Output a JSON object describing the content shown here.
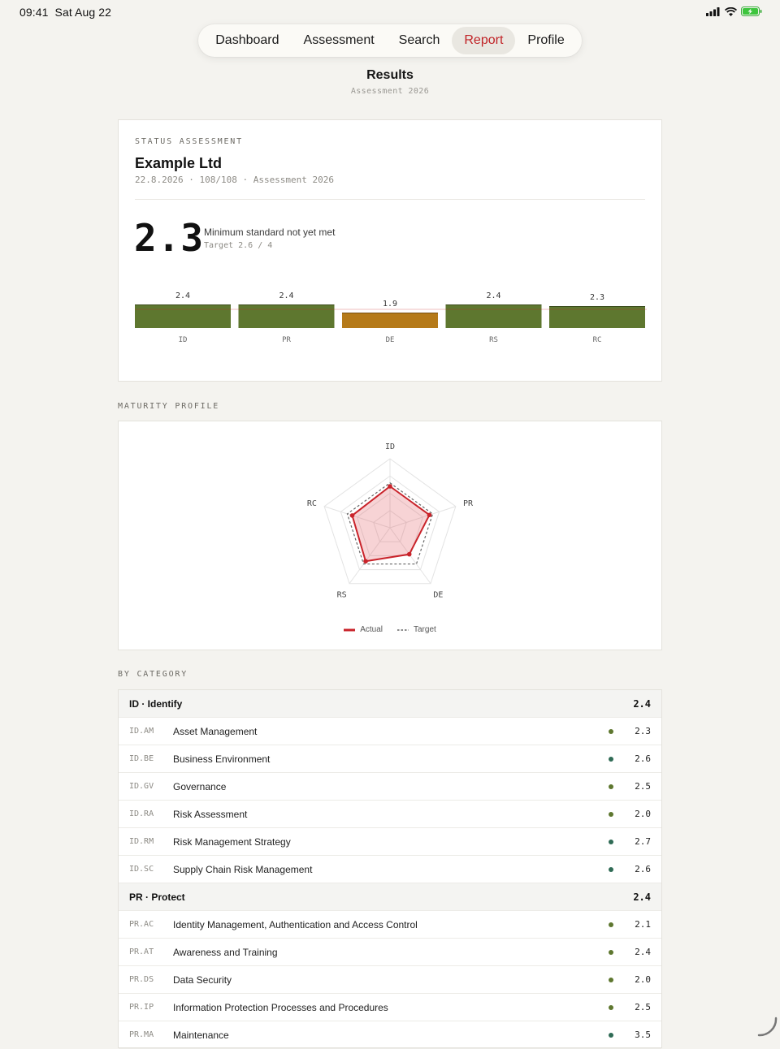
{
  "status_bar": {
    "time": "09:41",
    "date": "Sat Aug 22"
  },
  "nav": {
    "items": [
      {
        "label": "Dashboard",
        "active": false
      },
      {
        "label": "Assessment",
        "active": false
      },
      {
        "label": "Search",
        "active": false
      },
      {
        "label": "Report",
        "active": true
      },
      {
        "label": "Profile",
        "active": false
      }
    ]
  },
  "header": {
    "title": "Results",
    "subtitle": "Assessment 2026"
  },
  "status_card": {
    "eyebrow": "STATUS ASSESSMENT",
    "company": "Example Ltd",
    "meta": "22.8.2026 · 108/108 · Assessment 2026",
    "score": "2.3",
    "score_text": "Minimum standard not yet met",
    "target_text": "Target 2.6 / 4"
  },
  "colors": {
    "green": "#5e772f",
    "amber": "#b57a19",
    "red": "#c9232a",
    "accent": "#c02226",
    "dot_olive": "#5e772f",
    "dot_teal": "#2f6b55"
  },
  "chart_data": [
    {
      "type": "bar",
      "categories": [
        "ID",
        "PR",
        "DE",
        "RS",
        "RC"
      ],
      "values": [
        2.4,
        2.4,
        1.9,
        2.4,
        2.3
      ],
      "labels": [
        "2.4",
        "2.4",
        "1.9",
        "2.4",
        "2.3"
      ],
      "target": 2.6,
      "ylim": [
        0,
        4
      ],
      "colors": [
        "#5e772f",
        "#5e772f",
        "#b57a19",
        "#5e772f",
        "#5e772f"
      ]
    },
    {
      "type": "radar",
      "axes": [
        "ID",
        "PR",
        "DE",
        "RS",
        "RC"
      ],
      "series": [
        {
          "name": "Actual",
          "values": [
            2.4,
            2.4,
            1.9,
            2.4,
            2.3
          ]
        },
        {
          "name": "Target",
          "values": [
            2.6,
            2.6,
            2.6,
            2.6,
            2.6
          ]
        }
      ],
      "range": [
        0,
        4
      ]
    }
  ],
  "radar_section_label": "MATURITY PROFILE",
  "category_section_label": "BY CATEGORY",
  "categories": [
    {
      "name": "ID · Identify",
      "score": "2.4",
      "rows": [
        {
          "code": "ID.AM",
          "name": "Asset Management",
          "score": "2.3",
          "dot": "olive"
        },
        {
          "code": "ID.BE",
          "name": "Business Environment",
          "score": "2.6",
          "dot": "teal"
        },
        {
          "code": "ID.GV",
          "name": "Governance",
          "score": "2.5",
          "dot": "olive"
        },
        {
          "code": "ID.RA",
          "name": "Risk Assessment",
          "score": "2.0",
          "dot": "olive"
        },
        {
          "code": "ID.RM",
          "name": "Risk Management Strategy",
          "score": "2.7",
          "dot": "teal"
        },
        {
          "code": "ID.SC",
          "name": "Supply Chain Risk Management",
          "score": "2.6",
          "dot": "teal"
        }
      ]
    },
    {
      "name": "PR · Protect",
      "score": "2.4",
      "rows": [
        {
          "code": "PR.AC",
          "name": "Identity Management, Authentication and Access Control",
          "score": "2.1",
          "dot": "olive"
        },
        {
          "code": "PR.AT",
          "name": "Awareness and Training",
          "score": "2.4",
          "dot": "olive"
        },
        {
          "code": "PR.DS",
          "name": "Data Security",
          "score": "2.0",
          "dot": "olive"
        },
        {
          "code": "PR.IP",
          "name": "Information Protection Processes and Procedures",
          "score": "2.5",
          "dot": "olive"
        },
        {
          "code": "PR.MA",
          "name": "Maintenance",
          "score": "3.5",
          "dot": "teal"
        }
      ]
    }
  ]
}
